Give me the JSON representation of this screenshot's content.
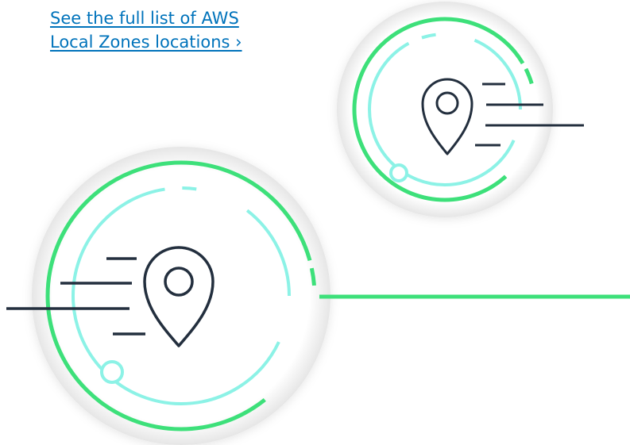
{
  "link": {
    "line1": "See the full list of AWS ",
    "line2": "Local Zones locations ›"
  },
  "colors": {
    "link": "#0073bb",
    "green": "#3de07a",
    "aqua": "#8cf2e6",
    "dark": "#232f3e",
    "shadow": "#e4e4e4"
  },
  "icons": [
    "location-pin-icon",
    "speed-lines-icon"
  ]
}
